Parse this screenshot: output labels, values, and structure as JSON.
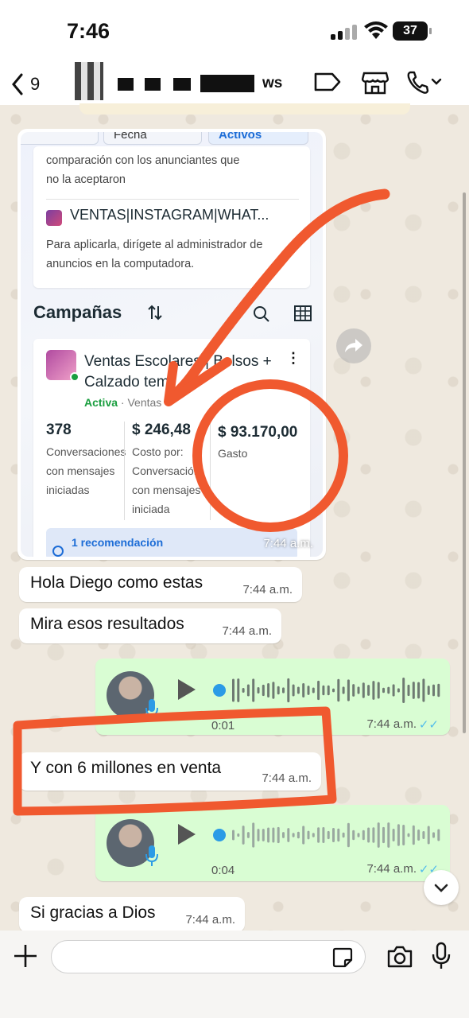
{
  "status": {
    "time": "7:46",
    "battery": "37"
  },
  "header": {
    "back_count": "9",
    "title_tail": "ws",
    "icons": [
      "label-icon",
      "store-icon",
      "phone-icon"
    ]
  },
  "image_message": {
    "tabs": [
      "Fecha",
      "Activos"
    ],
    "card1_text": "comparación con los anunciantes que no la aceptaron",
    "account_name": "VENTAS|INSTAGRAM|WHAT...",
    "card1_hint": "Para aplicarla, dirígete al administrador de anuncios en la computadora.",
    "section_title": "Campañas",
    "campaign_name": "Ventas Escolares | Bolsos + Calzado tem",
    "campaign_status": "Activa",
    "campaign_objective": "Ventas",
    "stats": [
      {
        "value": "378",
        "label": "Conversaciones con mensajes iniciadas"
      },
      {
        "value": "$ 246,48",
        "label": "Costo por: Conversación con mensajes iniciada"
      },
      {
        "value": "$ 93.170,00",
        "label": "Gasto"
      }
    ],
    "recommendation": "1 recomendación",
    "time": "7:44 a.m."
  },
  "messages": [
    {
      "text": "Hola Diego como estas",
      "time": "7:44 a.m."
    },
    {
      "text": "Mira esos resultados",
      "time": "7:44 a.m."
    },
    {
      "text": "Y con 6 millones en venta",
      "time": "7:44 a.m."
    },
    {
      "text": "Si gracias a Dios",
      "time": "7:44 a.m."
    }
  ],
  "audio_messages": [
    {
      "duration": "0:01",
      "time": "7:44 a.m.",
      "ticks": "✓✓"
    },
    {
      "duration": "0:04",
      "time": "7:44 a.m.",
      "ticks": "✓✓"
    }
  ],
  "composer": {
    "placeholder": ""
  },
  "annotation_color": "#f0592f",
  "accent_blue": "#53bdeb",
  "outgoing_bubble": "#d9fdd3"
}
